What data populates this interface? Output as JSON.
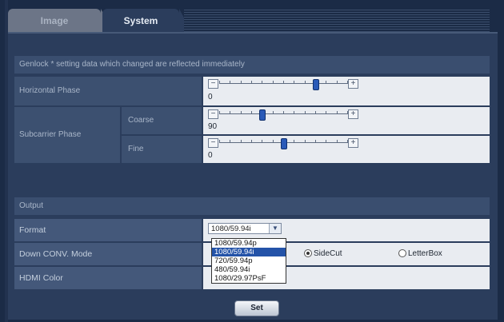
{
  "tabs": [
    {
      "label": "Image"
    },
    {
      "label": "System"
    }
  ],
  "genlock": {
    "header": "Genlock * setting data which changed are reflected immediately",
    "horizontal_phase": {
      "label": "Horizontal Phase",
      "value": "0",
      "level": 0.75
    },
    "subcarrier_phase": {
      "label": "Subcarrier Phase",
      "coarse": {
        "label": "Coarse",
        "value": "90",
        "level": 0.33
      },
      "fine": {
        "label": "Fine",
        "value": "0",
        "level": 0.5
      }
    }
  },
  "output": {
    "header": "Output",
    "format": {
      "label": "Format",
      "selected": "1080/59.94i",
      "options": [
        "1080/59.94p",
        "1080/59.94i",
        "720/59.94p",
        "480/59.94i",
        "1080/29.97PsF"
      ],
      "highlighted_index": 1
    },
    "down_conv_mode": {
      "label": "Down CONV. Mode",
      "options": [
        {
          "label": "SideCut",
          "checked": true
        },
        {
          "label": "LetterBox",
          "checked": false
        }
      ]
    },
    "hdmi_color": {
      "label": "HDMI Color"
    }
  },
  "set_button": "Set",
  "slider": {
    "minus": "−",
    "plus": "+"
  },
  "icons": {
    "select_arrow": "chevron-down-icon"
  }
}
